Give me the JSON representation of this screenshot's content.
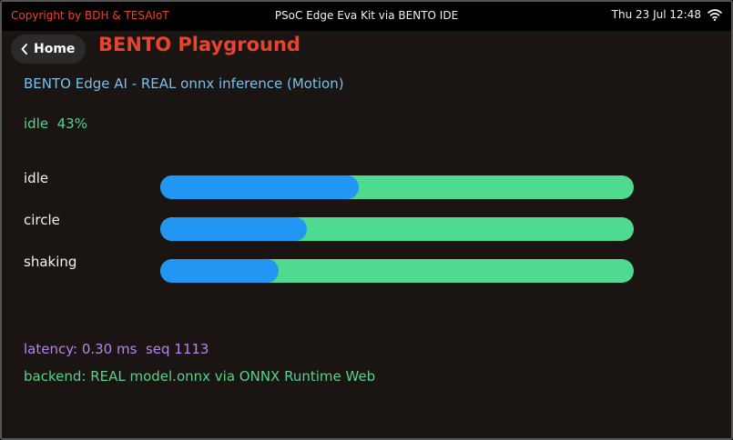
{
  "status_bar": {
    "copyright": "Copyright by BDH & TESAIoT",
    "title": "PSoC Edge Eva Kit via BENTO IDE",
    "datetime": "Thu 23 Jul 12:48",
    "wifi_icon": "wifi-icon"
  },
  "header": {
    "home_label": "Home",
    "back_icon": "chevron-left-icon",
    "title": "BENTO Playground"
  },
  "main": {
    "subtitle": "BENTO Edge AI - REAL onnx inference (Motion)",
    "top_result": "idle  43%",
    "classes": [
      {
        "label": "idle",
        "fraction": 0.42
      },
      {
        "label": "circle",
        "fraction": 0.31
      },
      {
        "label": "shaking",
        "fraction": 0.25
      }
    ],
    "latency": "latency: 0.30 ms  seq 1113",
    "backend": "backend: REAL model.onnx via ONNX Runtime Web"
  },
  "colors": {
    "accent_red": "#e8442d",
    "bar_fill": "#2196f3",
    "bar_track": "#4fd991",
    "info_blue": "#73c2ee",
    "result_green": "#52d48d",
    "latency_purple": "#b884ec"
  }
}
